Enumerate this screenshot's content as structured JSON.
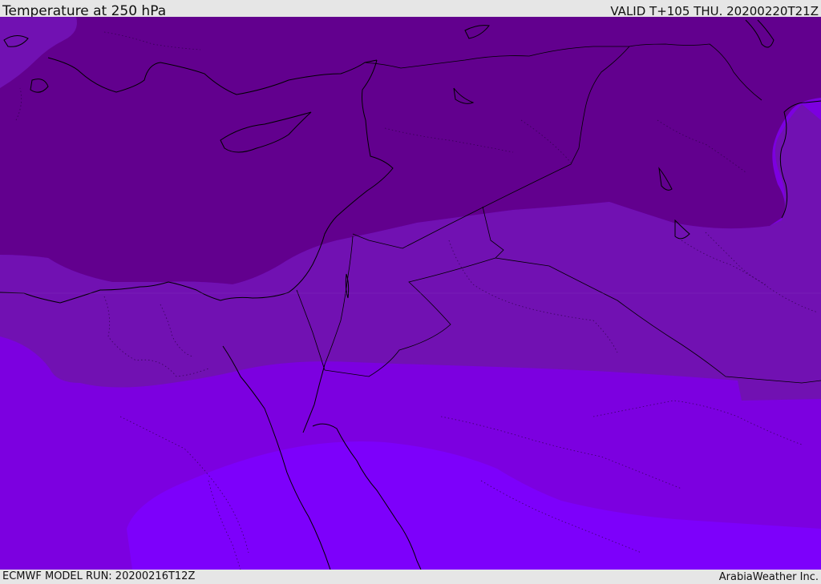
{
  "header": {
    "title": "Temperature at 250 hPa",
    "valid": "VALID T+105 THU. 20200220T21Z"
  },
  "footer": {
    "model_run": "ECMWF MODEL RUN: 20200216T12Z",
    "credit": "ArabiaWeather Inc."
  },
  "map": {
    "fill_colors": {
      "coldest_band": "#62008e",
      "cold_band": "#7111b2",
      "mid_band": "#7c00e0",
      "warm_band": "#7d00fb"
    },
    "border_color": "#000000"
  }
}
